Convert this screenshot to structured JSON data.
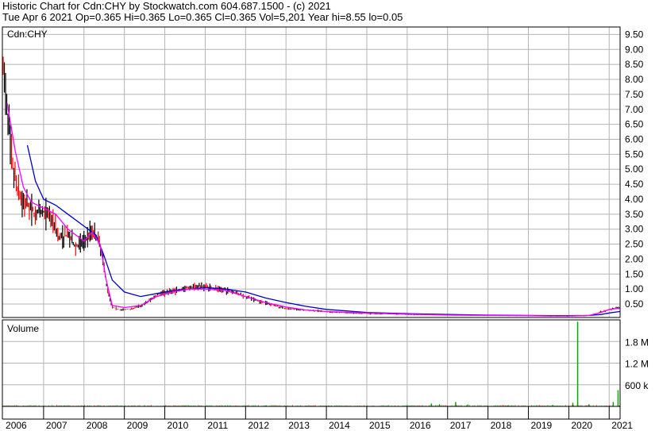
{
  "header": {
    "line1": "Historic Chart for Cdn:CHY by Stockwatch.com 604.687.1500 - (c) 2021",
    "line2": "Tue Apr  6 2021  Op=0.365  Hi=0.365  Lo=0.365  Cl=0.365  Vol=5,201  Year hi=8.55  lo=0.05"
  },
  "colors": {
    "price_bar": "#000000",
    "price_bar_down": "#ff0000",
    "ma_short": "#ff00ff",
    "ma_long": "#0000cc",
    "volume_bar": "#00aa00",
    "grid": "#b4b4b4",
    "border": "#000000"
  },
  "chart_data": [
    {
      "type": "bar",
      "title": "Cdn:CHY",
      "x_ticks": [
        "2006",
        "2007",
        "2008",
        "2009",
        "2010",
        "2011",
        "2012",
        "2013",
        "2014",
        "2015",
        "2016",
        "2017",
        "2018",
        "2019",
        "2020",
        "2021"
      ],
      "y_ticks": [
        "9.50",
        "9.00",
        "8.50",
        "8.00",
        "7.50",
        "7.00",
        "6.50",
        "6.00",
        "5.50",
        "5.00",
        "4.50",
        "4.00",
        "3.50",
        "3.00",
        "2.50",
        "2.00",
        "1.50",
        "1.00",
        "0.50"
      ],
      "ylim": [
        0.05,
        9.75
      ],
      "grid": true,
      "series": [
        {
          "kind": "price_close",
          "x": [
            2006.0,
            2006.1,
            2006.2,
            2006.3,
            2006.45,
            2006.6,
            2006.8,
            2007.0,
            2007.2,
            2007.4,
            2007.6,
            2007.8,
            2008.0,
            2008.2,
            2008.35,
            2008.45,
            2008.55,
            2008.7,
            2008.9,
            2009.2,
            2009.5,
            2009.8,
            2010.0,
            2010.3,
            2010.6,
            2010.8,
            2011.0,
            2011.3,
            2011.6,
            2012.0,
            2012.3,
            2012.6,
            2013.0,
            2013.5,
            2014.0,
            2014.5,
            2015.0,
            2016.0,
            2017.0,
            2018.0,
            2019.0,
            2019.5,
            2020.0,
            2020.3,
            2020.6,
            2020.8,
            2021.0,
            2021.15,
            2021.26
          ],
          "values": [
            8.3,
            7.1,
            5.4,
            4.6,
            4.0,
            3.8,
            3.5,
            3.6,
            3.4,
            2.7,
            2.8,
            2.4,
            2.6,
            3.0,
            2.6,
            2.2,
            1.2,
            0.4,
            0.3,
            0.35,
            0.5,
            0.8,
            0.9,
            0.95,
            1.05,
            1.1,
            1.1,
            1.0,
            0.95,
            0.75,
            0.6,
            0.5,
            0.35,
            0.3,
            0.25,
            0.2,
            0.18,
            0.15,
            0.13,
            0.12,
            0.11,
            0.1,
            0.09,
            0.1,
            0.12,
            0.25,
            0.3,
            0.38,
            0.365
          ]
        },
        {
          "kind": "moving_average_short",
          "x": [
            2006.1,
            2006.3,
            2006.5,
            2006.7,
            2007.0,
            2007.3,
            2007.6,
            2008.0,
            2008.2,
            2008.4,
            2008.55,
            2008.7,
            2009.0,
            2009.4,
            2009.8,
            2010.2,
            2010.6,
            2011.0,
            2011.5,
            2012.0,
            2012.5,
            2013.0,
            2013.5,
            2014.0,
            2015.0,
            2016.0,
            2017.0,
            2018.0,
            2019.0,
            2019.5,
            2020.0,
            2020.5,
            2020.8,
            2021.0,
            2021.26
          ],
          "values": [
            7.2,
            5.6,
            4.4,
            3.9,
            3.7,
            3.5,
            3.0,
            2.6,
            2.9,
            2.5,
            1.3,
            0.45,
            0.38,
            0.45,
            0.75,
            0.9,
            1.0,
            1.0,
            0.95,
            0.75,
            0.55,
            0.4,
            0.3,
            0.25,
            0.2,
            0.16,
            0.13,
            0.12,
            0.11,
            0.1,
            0.1,
            0.12,
            0.22,
            0.32,
            0.36
          ]
        },
        {
          "kind": "moving_average_long",
          "x": [
            2006.6,
            2006.8,
            2007.0,
            2007.3,
            2007.6,
            2008.0,
            2008.3,
            2008.5,
            2008.7,
            2009.0,
            2009.4,
            2009.8,
            2010.2,
            2010.6,
            2011.0,
            2011.5,
            2012.0,
            2012.5,
            2013.0,
            2013.5,
            2014.0,
            2015.0,
            2016.0,
            2017.0,
            2018.0,
            2019.0,
            2019.5,
            2020.0,
            2020.5,
            2020.8,
            2021.0,
            2021.26
          ],
          "values": [
            5.8,
            4.6,
            4.0,
            3.8,
            3.5,
            3.1,
            2.8,
            2.1,
            1.3,
            0.9,
            0.75,
            0.85,
            0.95,
            1.0,
            1.05,
            1.0,
            0.9,
            0.7,
            0.55,
            0.42,
            0.32,
            0.22,
            0.18,
            0.15,
            0.13,
            0.12,
            0.11,
            0.11,
            0.12,
            0.15,
            0.2,
            0.25
          ]
        }
      ]
    },
    {
      "type": "bar",
      "title": "Volume",
      "y_ticks": [
        "1.8 M",
        "1.2 M",
        "600 k"
      ],
      "ylim": [
        0,
        2400000
      ],
      "grid": true,
      "series": [
        {
          "kind": "volume",
          "x": [
            2006.5,
            2007.5,
            2008.5,
            2009.5,
            2010.5,
            2011.5,
            2012.5,
            2013.5,
            2014.5,
            2015.5,
            2016.6,
            2016.8,
            2017.2,
            2017.5,
            2018.5,
            2019.6,
            2020.1,
            2020.22,
            2020.5,
            2021.1,
            2021.22
          ],
          "values": [
            20000,
            20000,
            15000,
            20000,
            25000,
            25000,
            20000,
            15000,
            15000,
            20000,
            80000,
            60000,
            120000,
            50000,
            30000,
            40000,
            100000,
            2350000,
            60000,
            120000,
            450000
          ]
        }
      ]
    }
  ]
}
